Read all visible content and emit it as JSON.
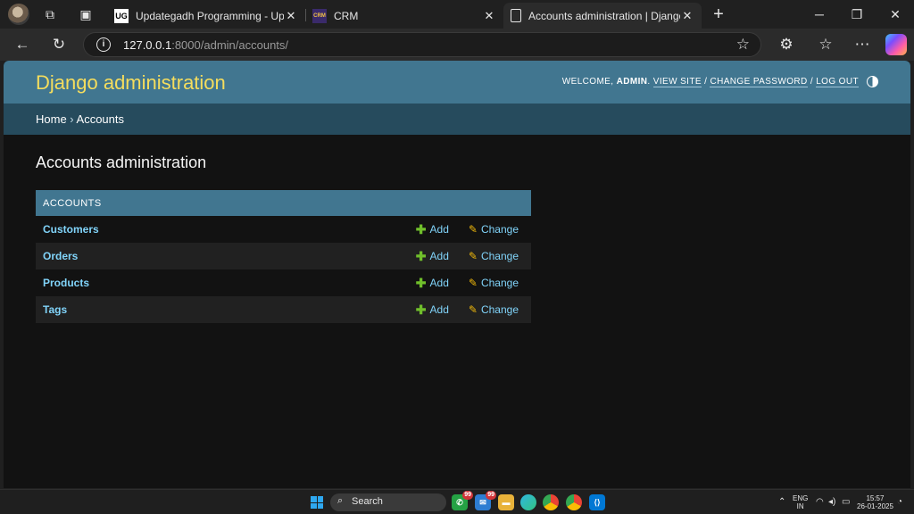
{
  "browser": {
    "tabs": [
      {
        "title": "Updategadh Programming - Upd",
        "favicon": "UG"
      },
      {
        "title": "CRM",
        "favicon": "CRM"
      },
      {
        "title": "Accounts administration | Django",
        "favicon": "page"
      }
    ],
    "url_host": "127.0.0.1",
    "url_rest": ":8000/admin/accounts/"
  },
  "admin": {
    "branding": "Django administration",
    "welcome": "WELCOME, ",
    "username": "ADMIN",
    "view_site": "VIEW SITE",
    "change_password": "CHANGE PASSWORD",
    "log_out": "LOG OUT",
    "sep": " / ",
    "breadcrumb_home": "Home",
    "breadcrumb_sep": " › ",
    "breadcrumb_current": "Accounts",
    "page_title": "Accounts administration",
    "module_caption": "ACCOUNTS",
    "add_label": "Add",
    "change_label": "Change",
    "models": [
      {
        "name": "Customers"
      },
      {
        "name": "Orders"
      },
      {
        "name": "Products"
      },
      {
        "name": "Tags"
      }
    ]
  },
  "taskbar": {
    "search_label": "Search",
    "badge": "99",
    "lang_top": "ENG",
    "lang_bottom": "IN",
    "time": "15:57",
    "date": "26-01-2025"
  },
  "colors": {
    "header": "#417690",
    "breadcrumb_bg": "#264b5d",
    "brand_text": "#f5dd5d",
    "link": "#81d4fa",
    "add_icon": "#70bf2b",
    "change_icon": "#efb80b"
  }
}
